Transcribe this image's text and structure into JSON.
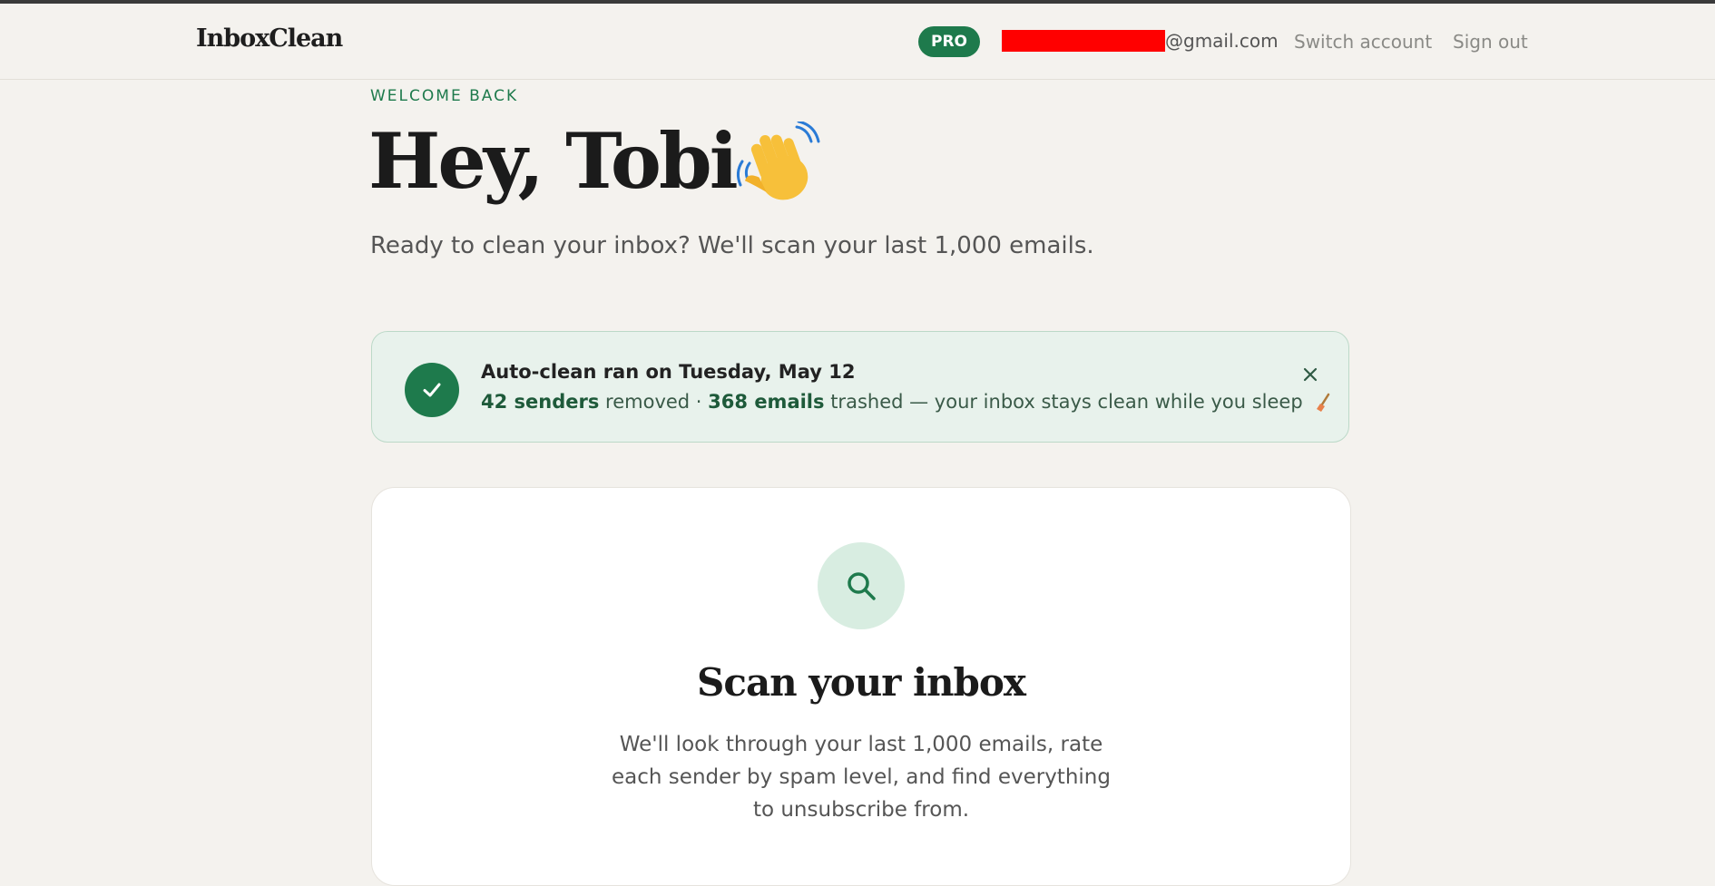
{
  "header": {
    "logo": "InboxClean",
    "badge": "PRO",
    "email_suffix": "@gmail.com",
    "switch_account": "Switch account",
    "sign_out": "Sign out"
  },
  "hero": {
    "eyebrow": "WELCOME BACK",
    "greeting": "Hey, Tobi",
    "emoji": "waving-hand-icon",
    "subtitle": "Ready to clean your inbox? We'll scan your last 1,000 emails."
  },
  "banner": {
    "title": "Auto-clean ran on Tuesday, May 12",
    "senders_count": "42 senders",
    "removed_text": "removed ·",
    "emails_count": "368 emails",
    "trashed_text": "trashed — your inbox stays clean while you sleep",
    "icon": "check-icon",
    "colors": {
      "accent": "#1e7a4c",
      "background": "#e8f2ec"
    }
  },
  "scan_card": {
    "icon": "search-icon",
    "title": "Scan your inbox",
    "description": "We'll look through your last 1,000 emails, rate each sender by spam level, and find everything to unsubscribe from."
  }
}
